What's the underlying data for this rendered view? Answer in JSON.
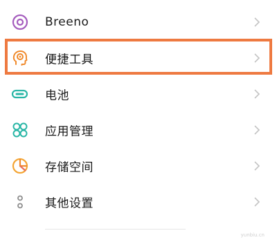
{
  "settings_list": {
    "items": [
      {
        "label": "Breeno",
        "icon": "breeno-icon",
        "color": "#a45bbd"
      },
      {
        "label": "便捷工具",
        "icon": "convenience-tools-icon",
        "color": "#f08a2c"
      },
      {
        "label": "电池",
        "icon": "battery-icon",
        "color": "#29b6a6"
      },
      {
        "label": "应用管理",
        "icon": "app-management-icon",
        "color": "#29b6a6"
      },
      {
        "label": "存储空间",
        "icon": "storage-icon",
        "color": "#f4a534"
      },
      {
        "label": "其他设置",
        "icon": "other-settings-icon",
        "color": "#9a9a9a"
      }
    ],
    "selected_index": 1,
    "highlight_color": "#ee7a41"
  },
  "watermark": "yunbiu.cn"
}
